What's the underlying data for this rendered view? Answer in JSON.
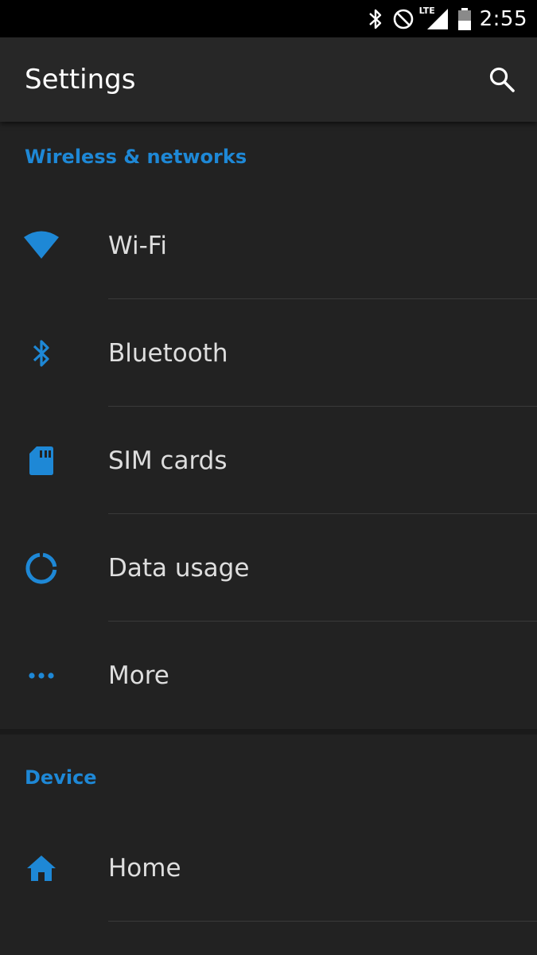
{
  "status_bar": {
    "icons": [
      "bluetooth-icon",
      "do-not-disturb-icon",
      "lte-signal-icon",
      "battery-icon"
    ],
    "network_label": "LTE",
    "time": "2:55"
  },
  "app_bar": {
    "title": "Settings",
    "search_icon": "search-icon"
  },
  "colors": {
    "accent": "#1e88d6",
    "background": "#222222",
    "app_bar": "#272727",
    "status_bar": "#000000",
    "text": "#dedede"
  },
  "sections": [
    {
      "header": "Wireless & networks",
      "items": [
        {
          "label": "Wi-Fi",
          "icon": "wifi-icon"
        },
        {
          "label": "Bluetooth",
          "icon": "bluetooth-icon"
        },
        {
          "label": "SIM cards",
          "icon": "sim-card-icon"
        },
        {
          "label": "Data usage",
          "icon": "data-usage-icon"
        },
        {
          "label": "More",
          "icon": "more-dots-icon"
        }
      ]
    },
    {
      "header": "Device",
      "items": [
        {
          "label": "Home",
          "icon": "home-icon"
        }
      ]
    }
  ]
}
